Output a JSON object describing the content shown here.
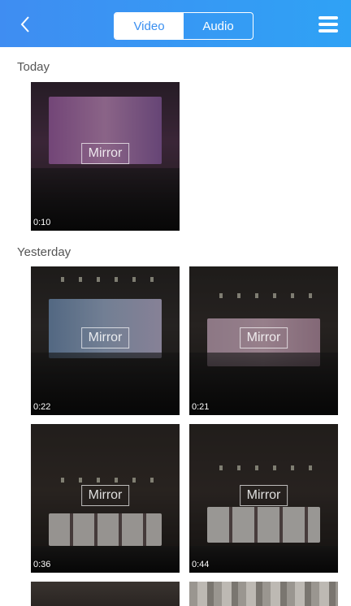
{
  "header": {
    "back_icon": "chevron-left-icon",
    "tabs": [
      {
        "label": "Video",
        "active": true
      },
      {
        "label": "Audio",
        "active": false
      }
    ],
    "menu_icon": "hamburger-menu-icon",
    "colors": {
      "bar_start": "#3f8df2",
      "bar_end": "#2fa2f5"
    }
  },
  "sections": [
    {
      "label": "Today",
      "items": [
        {
          "overlay": "Mirror",
          "duration": "0:10"
        }
      ]
    },
    {
      "label": "Yesterday",
      "items": [
        {
          "overlay": "Mirror",
          "duration": "0:22"
        },
        {
          "overlay": "Mirror",
          "duration": "0:21"
        },
        {
          "overlay": "Mirror",
          "duration": "0:36"
        },
        {
          "overlay": "Mirror",
          "duration": "0:44"
        }
      ]
    }
  ]
}
